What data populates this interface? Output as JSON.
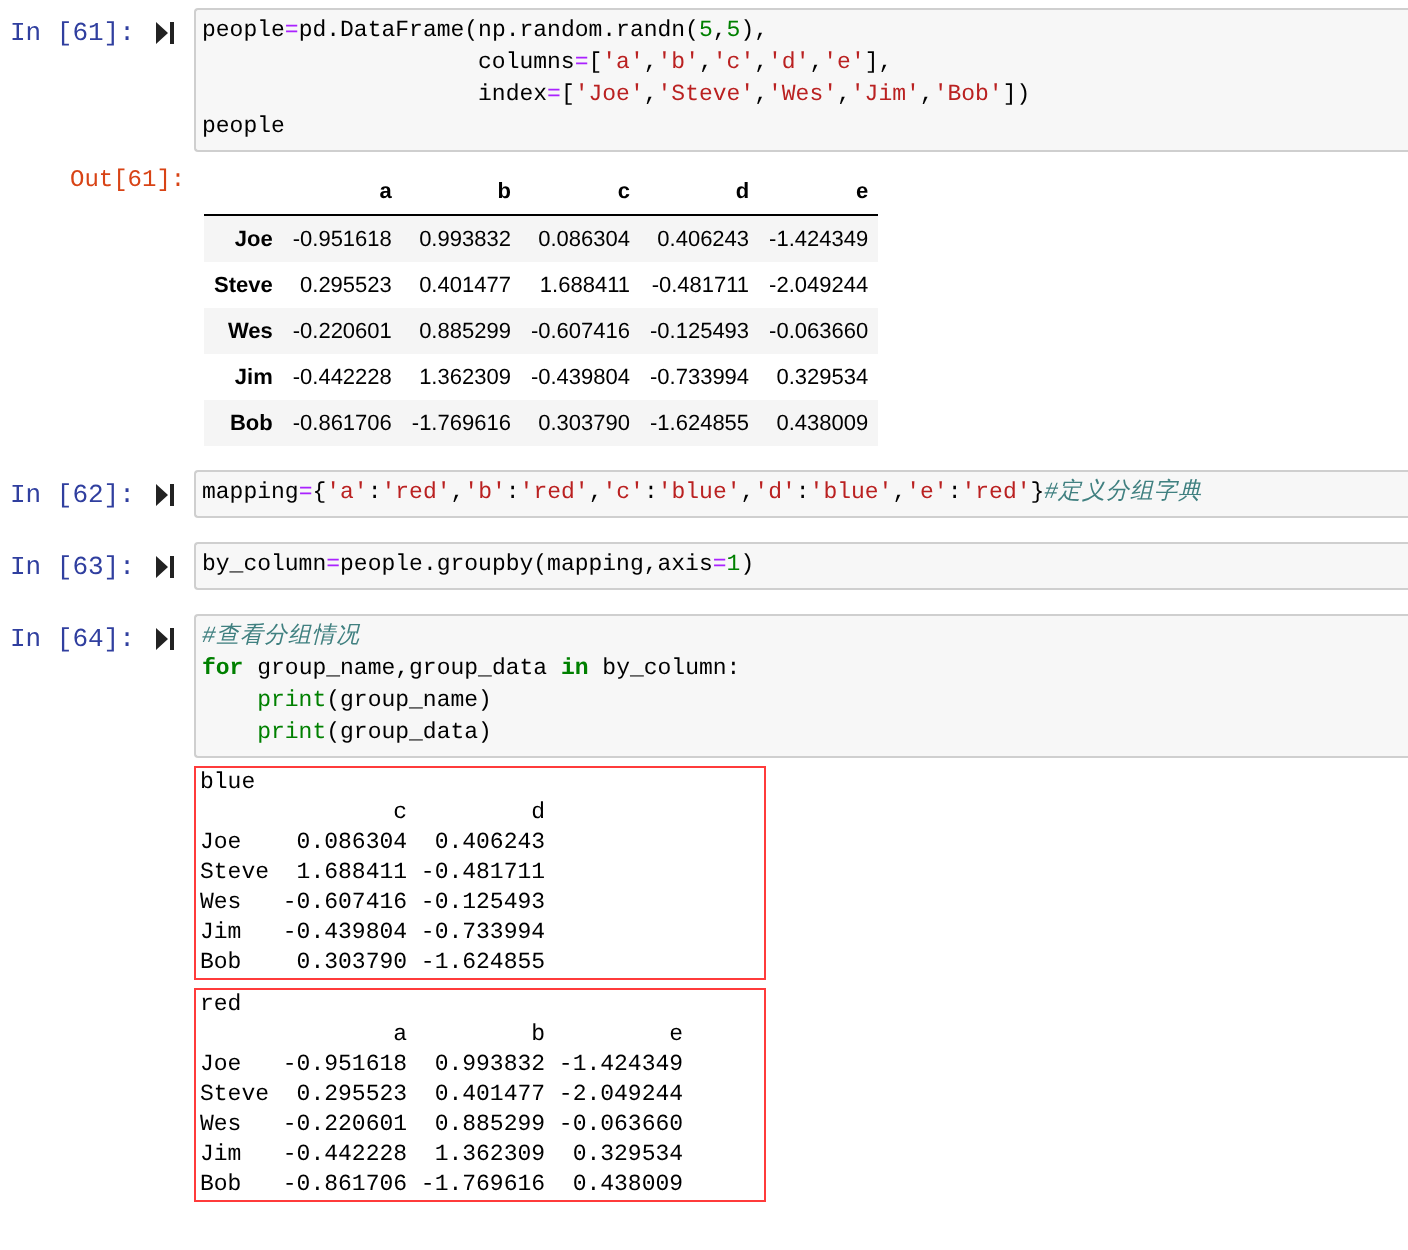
{
  "cells": [
    {
      "prompt": "In [61]:",
      "code": [
        [
          {
            "kind": "plain",
            "text": "people"
          },
          {
            "kind": "op",
            "text": "="
          },
          {
            "kind": "plain",
            "text": "pd.DataFrame(np.random.randn("
          },
          {
            "kind": "num",
            "text": "5"
          },
          {
            "kind": "plain",
            "text": ","
          },
          {
            "kind": "num",
            "text": "5"
          },
          {
            "kind": "plain",
            "text": "),"
          }
        ],
        [
          {
            "kind": "plain",
            "text": "                    columns"
          },
          {
            "kind": "op",
            "text": "="
          },
          {
            "kind": "plain",
            "text": "["
          },
          {
            "kind": "str",
            "text": "'a'"
          },
          {
            "kind": "plain",
            "text": ","
          },
          {
            "kind": "str",
            "text": "'b'"
          },
          {
            "kind": "plain",
            "text": ","
          },
          {
            "kind": "str",
            "text": "'c'"
          },
          {
            "kind": "plain",
            "text": ","
          },
          {
            "kind": "str",
            "text": "'d'"
          },
          {
            "kind": "plain",
            "text": ","
          },
          {
            "kind": "str",
            "text": "'e'"
          },
          {
            "kind": "plain",
            "text": "],"
          }
        ],
        [
          {
            "kind": "plain",
            "text": "                    index"
          },
          {
            "kind": "op",
            "text": "="
          },
          {
            "kind": "plain",
            "text": "["
          },
          {
            "kind": "str",
            "text": "'Joe'"
          },
          {
            "kind": "plain",
            "text": ","
          },
          {
            "kind": "str",
            "text": "'Steve'"
          },
          {
            "kind": "plain",
            "text": ","
          },
          {
            "kind": "str",
            "text": "'Wes'"
          },
          {
            "kind": "plain",
            "text": ","
          },
          {
            "kind": "str",
            "text": "'Jim'"
          },
          {
            "kind": "plain",
            "text": ","
          },
          {
            "kind": "str",
            "text": "'Bob'"
          },
          {
            "kind": "plain",
            "text": "])"
          }
        ],
        [
          {
            "kind": "plain",
            "text": "people"
          }
        ]
      ],
      "outputs": [
        {
          "kind": "dataframe",
          "prompt": "Out[61]:",
          "columns": [
            "a",
            "b",
            "c",
            "d",
            "e"
          ],
          "rows": [
            {
              "label": "Joe",
              "values": [
                "-0.951618",
                "0.993832",
                "0.086304",
                "0.406243",
                "-1.424349"
              ]
            },
            {
              "label": "Steve",
              "values": [
                "0.295523",
                "0.401477",
                "1.688411",
                "-0.481711",
                "-2.049244"
              ]
            },
            {
              "label": "Wes",
              "values": [
                "-0.220601",
                "0.885299",
                "-0.607416",
                "-0.125493",
                "-0.063660"
              ]
            },
            {
              "label": "Jim",
              "values": [
                "-0.442228",
                "1.362309",
                "-0.439804",
                "-0.733994",
                "0.329534"
              ]
            },
            {
              "label": "Bob",
              "values": [
                "-0.861706",
                "-1.769616",
                "0.303790",
                "-1.624855",
                "0.438009"
              ]
            }
          ]
        }
      ]
    },
    {
      "prompt": "In [62]:",
      "code": [
        [
          {
            "kind": "plain",
            "text": "mapping"
          },
          {
            "kind": "op",
            "text": "="
          },
          {
            "kind": "plain",
            "text": "{"
          },
          {
            "kind": "str",
            "text": "'a'"
          },
          {
            "kind": "plain",
            "text": ":"
          },
          {
            "kind": "str",
            "text": "'red'"
          },
          {
            "kind": "plain",
            "text": ","
          },
          {
            "kind": "str",
            "text": "'b'"
          },
          {
            "kind": "plain",
            "text": ":"
          },
          {
            "kind": "str",
            "text": "'red'"
          },
          {
            "kind": "plain",
            "text": ","
          },
          {
            "kind": "str",
            "text": "'c'"
          },
          {
            "kind": "plain",
            "text": ":"
          },
          {
            "kind": "str",
            "text": "'blue'"
          },
          {
            "kind": "plain",
            "text": ","
          },
          {
            "kind": "str",
            "text": "'d'"
          },
          {
            "kind": "plain",
            "text": ":"
          },
          {
            "kind": "str",
            "text": "'blue'"
          },
          {
            "kind": "plain",
            "text": ","
          },
          {
            "kind": "str",
            "text": "'e'"
          },
          {
            "kind": "plain",
            "text": ":"
          },
          {
            "kind": "str",
            "text": "'red'"
          },
          {
            "kind": "plain",
            "text": "}"
          },
          {
            "kind": "comment",
            "text": "#定义分组字典"
          }
        ]
      ]
    },
    {
      "prompt": "In [63]:",
      "code": [
        [
          {
            "kind": "plain",
            "text": "by_column"
          },
          {
            "kind": "op",
            "text": "="
          },
          {
            "kind": "plain",
            "text": "people.groupby(mapping,axis"
          },
          {
            "kind": "op",
            "text": "="
          },
          {
            "kind": "num",
            "text": "1"
          },
          {
            "kind": "plain",
            "text": ")"
          }
        ]
      ]
    },
    {
      "prompt": "In [64]:",
      "code": [
        [
          {
            "kind": "comment",
            "text": "#查看分组情况"
          }
        ],
        [
          {
            "kind": "kw",
            "text": "for"
          },
          {
            "kind": "plain",
            "text": " group_name,group_data "
          },
          {
            "kind": "kw",
            "text": "in"
          },
          {
            "kind": "plain",
            "text": " by_column:"
          }
        ],
        [
          {
            "kind": "builtin",
            "text": "    print"
          },
          {
            "kind": "plain",
            "text": "(group_name)"
          }
        ],
        [
          {
            "kind": "builtin",
            "text": "    print"
          },
          {
            "kind": "plain",
            "text": "(group_data)"
          }
        ]
      ],
      "outputs": [
        {
          "kind": "stream",
          "boxed": true,
          "lines": [
            "blue",
            "              c         d",
            "Joe    0.086304  0.406243",
            "Steve  1.688411 -0.481711",
            "Wes   -0.607416 -0.125493",
            "Jim   -0.439804 -0.733994",
            "Bob    0.303790 -1.624855"
          ]
        },
        {
          "kind": "stream",
          "boxed": true,
          "lines": [
            "red",
            "              a         b         e",
            "Joe   -0.951618  0.993832 -1.424349",
            "Steve  0.295523  0.401477 -2.049244",
            "Wes   -0.220601  0.885299 -0.063660",
            "Jim   -0.442228  1.362309  0.329534",
            "Bob   -0.861706 -1.769616  0.438009"
          ]
        }
      ]
    }
  ]
}
